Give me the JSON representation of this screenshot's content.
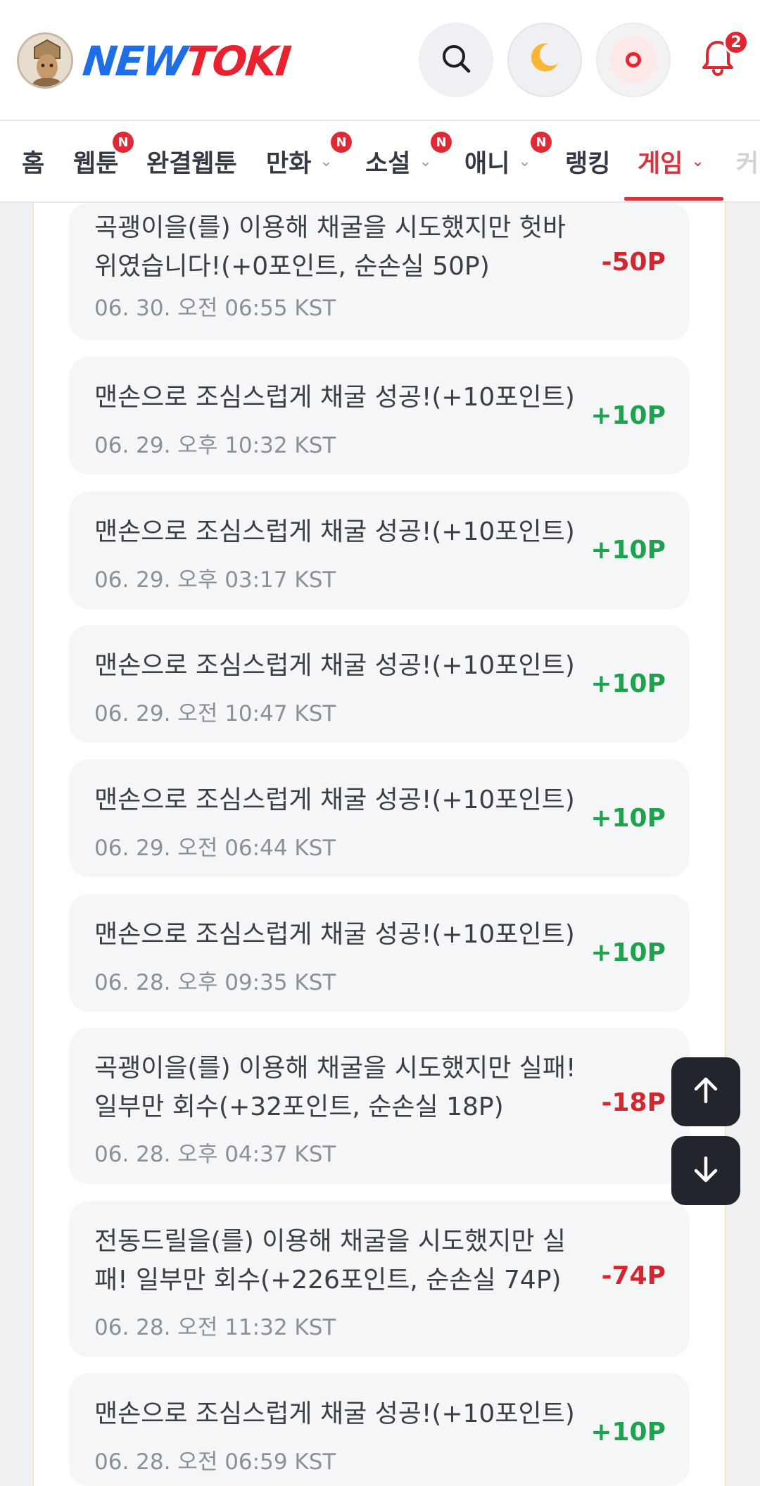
{
  "header": {
    "logo": {
      "part1": "NEW",
      "part2": "TOKI"
    },
    "notification_count": "2",
    "icons": [
      "search-icon",
      "moon-icon",
      "record-icon",
      "bell-icon"
    ]
  },
  "nav": {
    "items": [
      {
        "label": "홈",
        "new": false,
        "dropdown": false
      },
      {
        "label": "웹툰",
        "new": true,
        "dropdown": false
      },
      {
        "label": "완결웹툰",
        "new": false,
        "dropdown": false
      },
      {
        "label": "만화",
        "new": true,
        "dropdown": true
      },
      {
        "label": "소설",
        "new": true,
        "dropdown": true
      },
      {
        "label": "애니",
        "new": true,
        "dropdown": true
      },
      {
        "label": "랭킹",
        "new": false,
        "dropdown": false
      },
      {
        "label": "게임",
        "new": false,
        "dropdown": true,
        "active": true
      },
      {
        "label": "커",
        "new": false,
        "dropdown": false
      }
    ],
    "new_badge": "N"
  },
  "history": [
    {
      "desc_lines": [
        "곡괭이을(를) 이용해 채굴을 시도했지만 헛바",
        "위였습니다!(+0포인트, 순손실 50P)"
      ],
      "time": "06. 30. 오전 06:55 KST",
      "amount": "-50P",
      "sign": "neg"
    },
    {
      "desc_lines": [
        "맨손으로 조심스럽게 채굴 성공!(+10포인트)"
      ],
      "time": "06. 29. 오후 10:32 KST",
      "amount": "+10P",
      "sign": "pos"
    },
    {
      "desc_lines": [
        "맨손으로 조심스럽게 채굴 성공!(+10포인트)"
      ],
      "time": "06. 29. 오후 03:17 KST",
      "amount": "+10P",
      "sign": "pos"
    },
    {
      "desc_lines": [
        "맨손으로 조심스럽게 채굴 성공!(+10포인트)"
      ],
      "time": "06. 29. 오전 10:47 KST",
      "amount": "+10P",
      "sign": "pos"
    },
    {
      "desc_lines": [
        "맨손으로 조심스럽게 채굴 성공!(+10포인트)"
      ],
      "time": "06. 29. 오전 06:44 KST",
      "amount": "+10P",
      "sign": "pos"
    },
    {
      "desc_lines": [
        "맨손으로 조심스럽게 채굴 성공!(+10포인트)"
      ],
      "time": "06. 28. 오후 09:35 KST",
      "amount": "+10P",
      "sign": "pos"
    },
    {
      "desc_lines": [
        "곡괭이을(를) 이용해 채굴을 시도했지만 실패!",
        "일부만 회수(+32포인트, 순손실 18P)"
      ],
      "time": "06. 28. 오후 04:37 KST",
      "amount": "-18P",
      "sign": "neg"
    },
    {
      "desc_lines": [
        "전동드릴을(를) 이용해 채굴을 시도했지만 실",
        "패! 일부만 회수(+226포인트, 순손실 74P)"
      ],
      "time": "06. 28. 오전 11:32 KST",
      "amount": "-74P",
      "sign": "neg"
    },
    {
      "desc_lines": [
        "맨손으로 조심스럽게 채굴 성공!(+10포인트)"
      ],
      "time": "06. 28. 오전 06:59 KST",
      "amount": "+10P",
      "sign": "pos"
    }
  ],
  "floating": {
    "up_icon": "arrow-up-icon",
    "down_icon": "arrow-down-icon"
  },
  "colors": {
    "positive": "#1ea34d",
    "negative": "#d3262f",
    "accent": "#d6343f",
    "logo_blue": "#1e6ee8",
    "logo_red": "#e8222e"
  }
}
